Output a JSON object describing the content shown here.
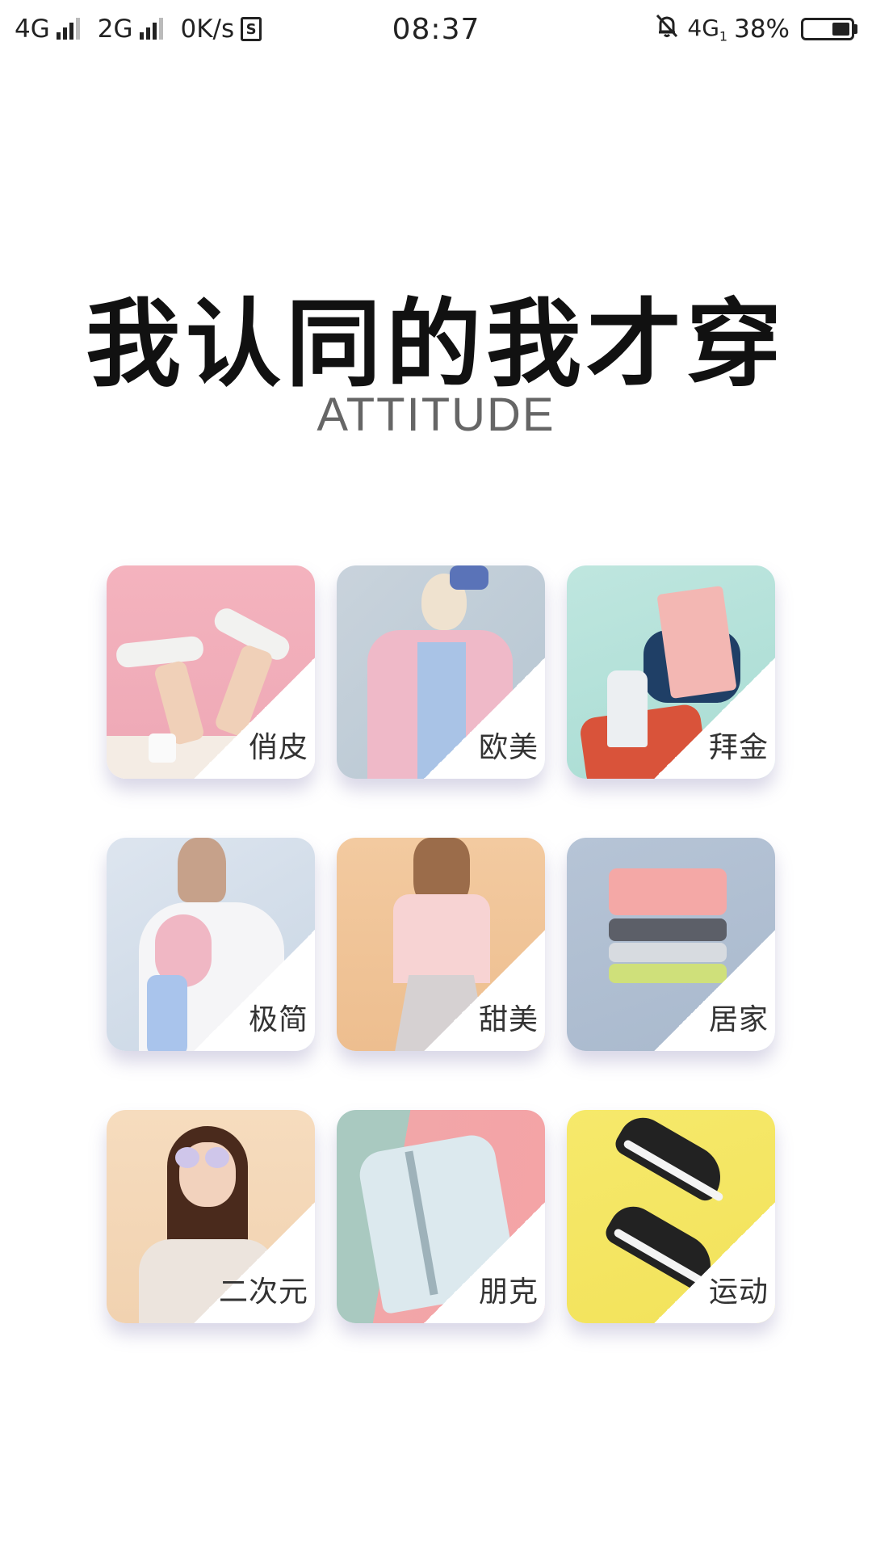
{
  "status_bar": {
    "net1": "4G",
    "net2": "2G",
    "speed": "0K/s",
    "sim_label": "S",
    "time": "08:37",
    "net3": "4G",
    "net3_sub": "1",
    "battery_text": "38%",
    "battery_level": 0.38
  },
  "headline": "我认同的我才穿",
  "subheadline": "ATTITUDE",
  "cards": [
    {
      "label": "俏皮"
    },
    {
      "label": "欧美"
    },
    {
      "label": "拜金"
    },
    {
      "label": "极简"
    },
    {
      "label": "甜美"
    },
    {
      "label": "居家"
    },
    {
      "label": "二次元"
    },
    {
      "label": "朋克"
    },
    {
      "label": "运动"
    }
  ]
}
